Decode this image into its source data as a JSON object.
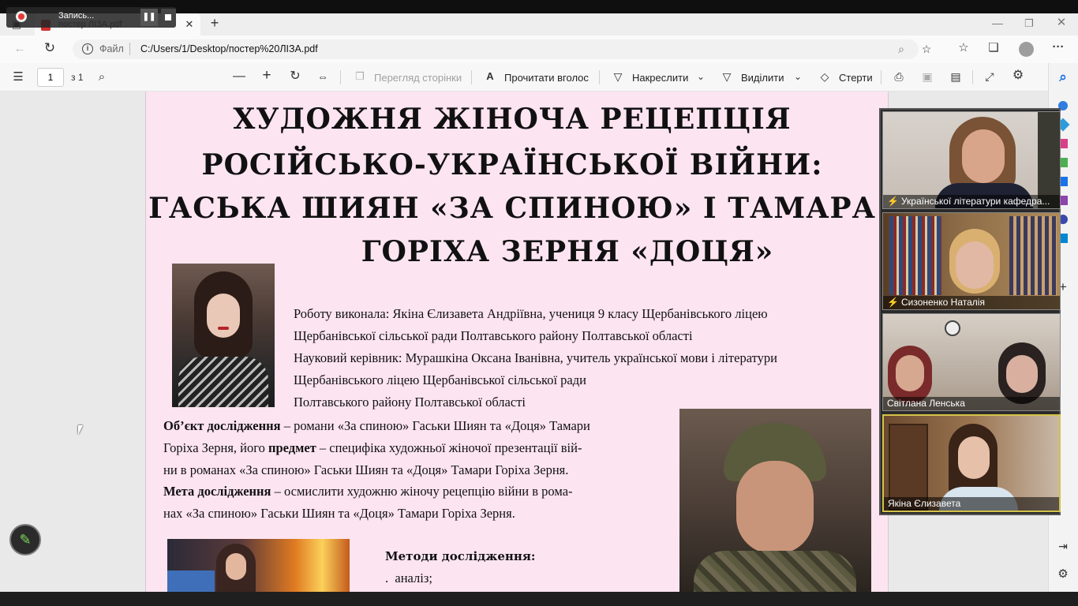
{
  "browser": {
    "tab_title": "постер ЛІЗА.pdf",
    "file_label": "Файл",
    "url": "C:/Users/1/Desktop/постер%20ЛІЗА.pdf"
  },
  "recording": {
    "label": "Запись..."
  },
  "pdf_toolbar": {
    "page_number": "1",
    "page_total": "з 1",
    "page_view": "Перегляд сторінки",
    "read_aloud": "Прочитати вголос",
    "draw": "Накреслити",
    "highlight": "Виділити",
    "erase": "Стерти"
  },
  "poster": {
    "title_lines": [
      "ХУДОЖНЯ ЖІНОЧА РЕЦЕПЦІЯ",
      "РОСІЙСЬКО-УКРАЇНСЬКОЇ ВІЙНИ:",
      "ГАСЬКА ШИЯН «ЗА СПИНОЮ» І ТАМАРА",
      "ГОРІХА ЗЕРНЯ «ДОЦЯ»"
    ],
    "author_lines": [
      "Роботу виконала: Якіна Єлизавета Андріївна, учениця 9 класу Щербанівського ліцею",
      "Щербанівської сільської ради Полтавського району Полтавської області",
      "Науковий керівник: Мурашкіна Оксана Іванівна, учитель української мови і літератури",
      "Щербанівського ліцею Щербанівської сільської ради",
      "Полтавського району Полтавської області"
    ],
    "object_label": "Об’єкт дослідження",
    "object_text1": " – романи «За спиною» Гаськи Шиян та «Доця» Тамари",
    "object_text2a": "Горіха Зерня, його ",
    "subject_label": "предмет",
    "object_text2b": " – специфіка художньої жіночої презентації вій-",
    "object_text3": "ни в романах «За спиною» Гаськи Шиян та «Доця» Тамари Горіха Зерня.",
    "goal_label": "Мета дослідження",
    "goal_text1": " – осмислити художню жіночу рецепцію війни в рома-",
    "goal_text2": "нах «За спиною» Гаськи Шиян та «Доця» Тамари Горіха Зерня.",
    "methods_title": "Методи дослідження:",
    "method1": "аналіз;",
    "method_bullet": "."
  },
  "video_participants": [
    {
      "name": "Української літератури кафедра...",
      "muted": true
    },
    {
      "name": "Сизоненко Наталія",
      "muted": true
    },
    {
      "name": "Світлана Ленська",
      "muted": false
    },
    {
      "name": "Якіна Єлизавета",
      "muted": false
    }
  ],
  "colors": {
    "page_bg": "#fde4f1",
    "active_speaker_border": "#d4c24a"
  }
}
